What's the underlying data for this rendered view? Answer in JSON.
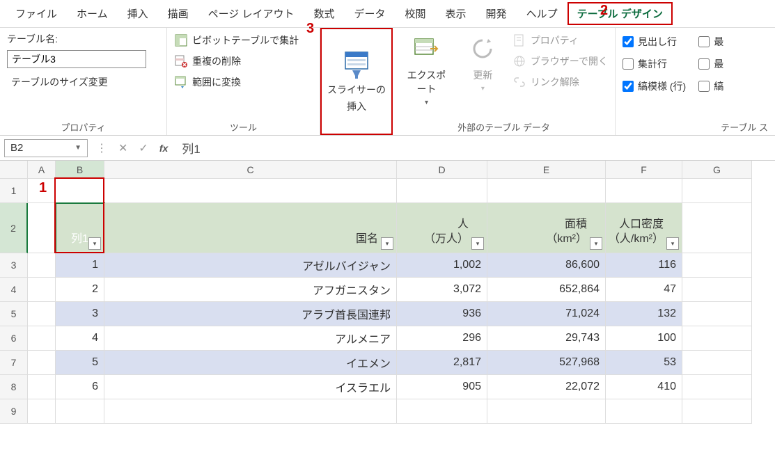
{
  "menu": {
    "items": [
      "ファイル",
      "ホーム",
      "挿入",
      "描画",
      "ページ レイアウト",
      "数式",
      "データ",
      "校閲",
      "表示",
      "開発",
      "ヘルプ",
      "テーブル デザイン"
    ]
  },
  "annotations": {
    "n1": "1",
    "n2": "2",
    "n3": "3"
  },
  "ribbon": {
    "properties": {
      "name_label": "テーブル名:",
      "name_value": "テーブル3",
      "resize": "テーブルのサイズ変更",
      "group": "プロパティ"
    },
    "tools": {
      "pivot": "ピボットテーブルで集計",
      "dedup": "重複の削除",
      "range": "範囲に変換",
      "group": "ツール"
    },
    "slicer": {
      "line1": "スライサーの",
      "line2": "挿入"
    },
    "export": "エクスポート",
    "refresh": "更新",
    "external": {
      "prop": "プロパティ",
      "browser": "ブラウザーで開く",
      "unlink": "リンク解除",
      "group": "外部のテーブル データ"
    },
    "styleopts": {
      "header": "見出し行",
      "total": "集計行",
      "banded": "縞模様 (行)",
      "last1": "最",
      "last2": "最",
      "last3": "縞",
      "group": "テーブル ス"
    }
  },
  "formula": {
    "namebox": "B2",
    "value": "列1"
  },
  "cols": [
    "A",
    "B",
    "C",
    "D",
    "E",
    "F",
    "G"
  ],
  "headers": {
    "b": "列1",
    "c": "国名",
    "d": "人\n（万人）",
    "e": "面積\n（km²）",
    "f": "人口密度\n（人/km²）"
  },
  "rows": [
    {
      "n": "1"
    },
    {
      "n": "2"
    },
    {
      "n": "3",
      "b": "1",
      "c": "アゼルバイジャン",
      "d": "1,002",
      "e": "86,600",
      "f": "116"
    },
    {
      "n": "4",
      "b": "2",
      "c": "アフガニスタン",
      "d": "3,072",
      "e": "652,864",
      "f": "47"
    },
    {
      "n": "5",
      "b": "3",
      "c": "アラブ首長国連邦",
      "d": "936",
      "e": "71,024",
      "f": "132"
    },
    {
      "n": "6",
      "b": "4",
      "c": "アルメニア",
      "d": "296",
      "e": "29,743",
      "f": "100"
    },
    {
      "n": "7",
      "b": "5",
      "c": "イエメン",
      "d": "2,817",
      "e": "527,968",
      "f": "53"
    },
    {
      "n": "8",
      "b": "6",
      "c": "イスラエル",
      "d": "905",
      "e": "22,072",
      "f": "410"
    },
    {
      "n": "9"
    }
  ]
}
